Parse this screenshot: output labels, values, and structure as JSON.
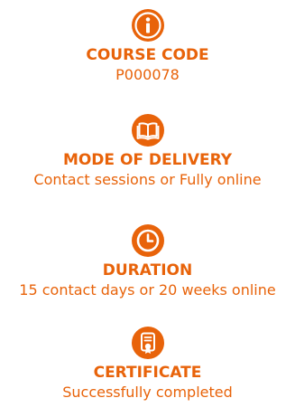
{
  "accent_color": "#e8630a",
  "items": [
    {
      "icon": "info-icon",
      "label": "COURSE CODE",
      "value": "P000078"
    },
    {
      "icon": "open-book-icon",
      "label": "MODE OF DELIVERY",
      "value": "Contact sessions or Fully online"
    },
    {
      "icon": "clock-icon",
      "label": "DURATION",
      "value": "15 contact days or 20 weeks online"
    },
    {
      "icon": "certificate-icon",
      "label": "CERTIFICATE",
      "value": "Successfully completed"
    }
  ]
}
